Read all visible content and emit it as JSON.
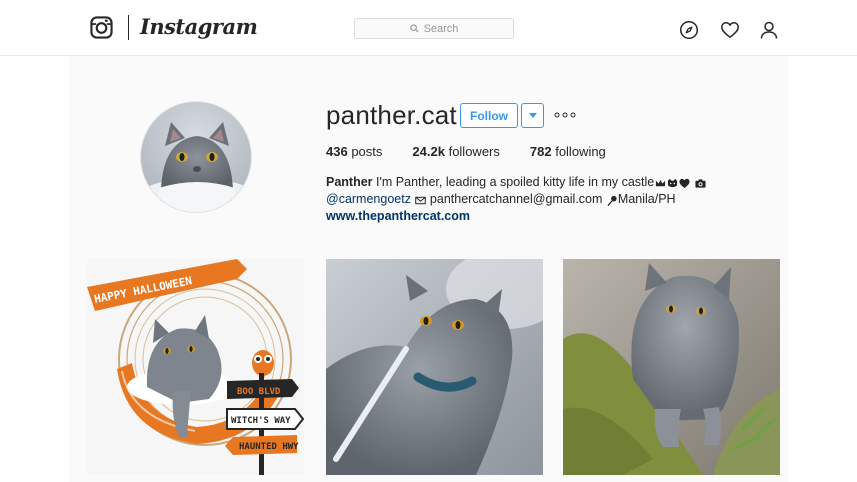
{
  "header": {
    "wordmark": "Instagram",
    "logo_icon": "instagram-camera-icon",
    "search_placeholder": "Search",
    "nav_icons": [
      "compass-icon",
      "heart-icon",
      "person-icon"
    ]
  },
  "profile": {
    "username": "panther.cat",
    "follow_label": "Follow",
    "dropdown_icon": "triangle-down-icon",
    "more_icon": "ellipsis-icon",
    "stats": {
      "posts_count": "436",
      "posts_label": "posts",
      "followers_count": "24.2k",
      "followers_label": "followers",
      "following_count": "782",
      "following_label": "following"
    },
    "bio": {
      "name": "Panther",
      "line1_text": "I'm Panther, leading a spoiled kitty life in my castle",
      "mention": "@carmengoetz",
      "email": "panthercatchannel@gmail.com",
      "location": "Manila/PH",
      "website": "www.thepanthercat.com"
    }
  },
  "posts": [
    {
      "label": "halloween-cat-photo",
      "banner_text": "HAPPY HALLOWEEN",
      "signs": [
        "BOO BLVD",
        "WITCH'S WAY",
        "HAUNTED HWY"
      ]
    },
    {
      "label": "cat-on-leash-photo"
    },
    {
      "label": "cat-walking-on-moss-photo"
    }
  ],
  "colors": {
    "accent_blue": "#3897f0",
    "link_blue": "#003569",
    "background": "#fafafa",
    "border": "#dbdbdb",
    "halloween_orange": "#e87722"
  }
}
